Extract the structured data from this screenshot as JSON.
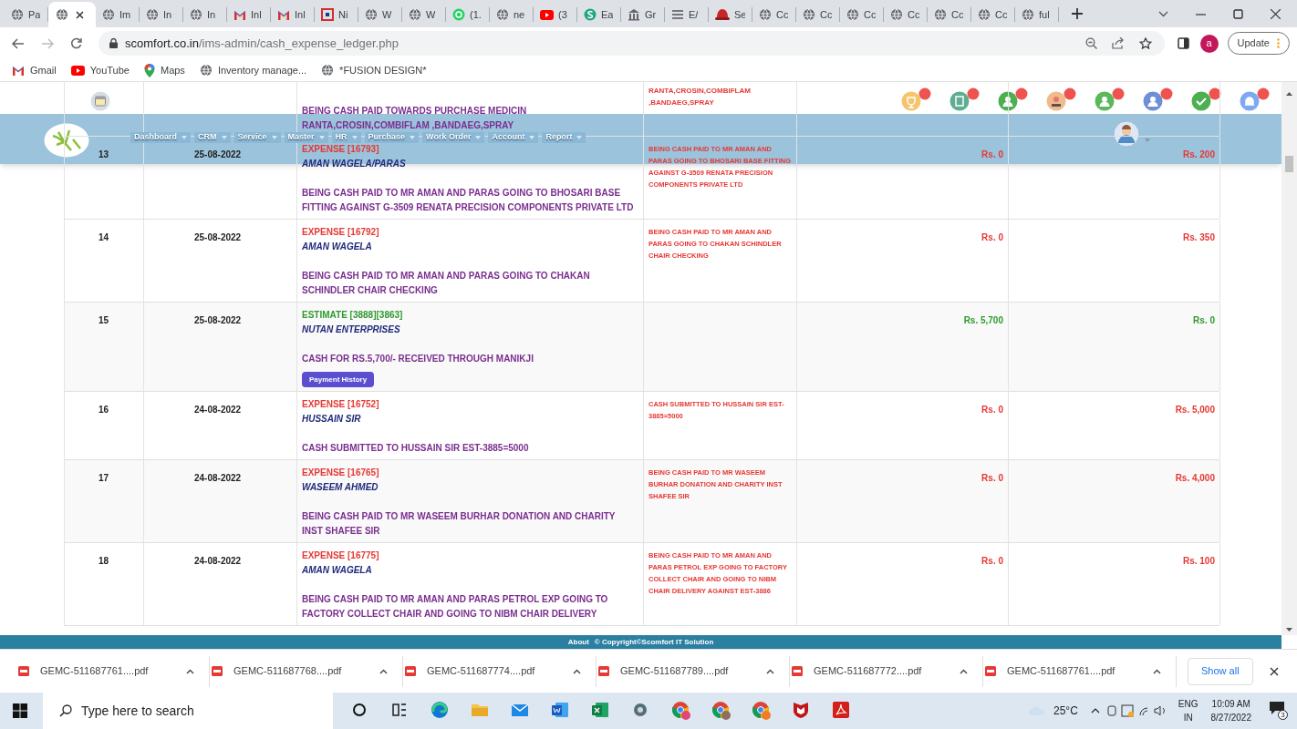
{
  "browser": {
    "tabs": [
      {
        "kind": "globe",
        "label": "Pa",
        "selected": false
      },
      {
        "kind": "globe",
        "selected": true
      },
      {
        "kind": "globe",
        "label": "Im",
        "selected": false
      },
      {
        "kind": "globe",
        "label": "In",
        "selected": false
      },
      {
        "kind": "globe",
        "label": "In",
        "selected": false
      },
      {
        "kind": "gmail",
        "label": "Inl",
        "selected": false
      },
      {
        "kind": "gmail",
        "label": "Inl",
        "selected": false
      },
      {
        "kind": "redbox",
        "label": "Ni",
        "selected": false
      },
      {
        "kind": "globe",
        "label": "W",
        "selected": false
      },
      {
        "kind": "globe",
        "label": "W",
        "selected": false
      },
      {
        "kind": "whatsapp",
        "label": "(1.",
        "selected": false
      },
      {
        "kind": "globe",
        "label": "ne",
        "selected": false
      },
      {
        "kind": "youtube",
        "label": "(3",
        "selected": false
      },
      {
        "kind": "scircle",
        "label": "Ea",
        "selected": false
      },
      {
        "kind": "building",
        "label": "Gr",
        "selected": false
      },
      {
        "kind": "bars",
        "label": "E/",
        "selected": false
      },
      {
        "kind": "hat",
        "label": "Se",
        "selected": false
      },
      {
        "kind": "globe",
        "label": "Cc",
        "selected": false
      },
      {
        "kind": "globe",
        "label": "Cc",
        "selected": false
      },
      {
        "kind": "globe",
        "label": "Cc",
        "selected": false
      },
      {
        "kind": "globe",
        "label": "Cc",
        "selected": false
      },
      {
        "kind": "globe",
        "label": "Cc",
        "selected": false
      },
      {
        "kind": "globe",
        "label": "Cc",
        "selected": false
      },
      {
        "kind": "globe",
        "label": "ful",
        "selected": false
      }
    ],
    "url_host": "scomfort.co.in",
    "url_path": "/ims-admin/cash_expense_ledger.php",
    "update_label": "Update",
    "profile_initial": "a",
    "bookmarks": [
      {
        "kind": "gmail",
        "label": "Gmail"
      },
      {
        "kind": "youtube",
        "label": "YouTube"
      },
      {
        "kind": "maps",
        "label": "Maps"
      },
      {
        "kind": "globe",
        "label": "Inventory manage..."
      },
      {
        "kind": "globe",
        "label": "*FUSION DESIGN*"
      }
    ]
  },
  "header": {
    "nav": [
      "Dashboard",
      "CRM",
      "Service",
      "Master",
      "HR",
      "Purchase",
      "Work Order",
      "Account",
      "Report"
    ],
    "notifications": [
      {
        "kind": "cup",
        "color": "#f5c56e"
      },
      {
        "kind": "document",
        "color": "#5fae93"
      },
      {
        "kind": "person",
        "color": "#4caf50"
      },
      {
        "kind": "people",
        "color": "#f2b98a"
      },
      {
        "kind": "person",
        "color": "#5cb85c"
      },
      {
        "kind": "person",
        "color": "#6d8fd6"
      },
      {
        "kind": "check",
        "color": "#4caf50"
      },
      {
        "kind": "bell",
        "color": "#7ea8f2"
      }
    ]
  },
  "ledger": {
    "partial_row": {
      "description_lines": [
        "BEING CASH PAID TOWARDS PURCHASE MEDICIN",
        "RANTA,CROSIN,COMBIFLAM ,BANDAEG,SPRAY"
      ],
      "remark_lines": [
        "RANTA,CROSIN,COMBIFLAM",
        ",BANDAEG,SPRAY"
      ]
    },
    "rows": [
      {
        "number": "13",
        "date": "25-08-2022",
        "kind": "expense",
        "type_label": "EXPENSE [16793]",
        "party": "AMAN WAGELA/PARAS",
        "description": "BEING CASH PAID TO MR AMAN AND PARAS GOING TO BHOSARI BASE FITTING AGAINST G-3509 RENATA PRECISION COMPONENTS PRIVATE LTD",
        "remark": "BEING CASH PAID TO MR AMAN AND PARAS GOING TO BHOSARI BASE FITTING AGAINST G-3509 RENATA PRECISION COMPONENTS PRIVATE LTD",
        "received": "Rs. 0",
        "paid": "Rs. 200"
      },
      {
        "number": "14",
        "date": "25-08-2022",
        "kind": "expense",
        "type_label": "EXPENSE [16792]",
        "party": "AMAN WAGELA",
        "description": "BEING CASH PAID TO MR AMAN AND PARAS GOING TO CHAKAN SCHINDLER CHAIR CHECKING",
        "remark": "BEING CASH PAID TO MR AMAN AND PARAS GOING TO CHAKAN SCHINDLER CHAIR CHECKING",
        "received": "Rs. 0",
        "paid": "Rs. 350"
      },
      {
        "number": "15",
        "date": "25-08-2022",
        "kind": "estimate",
        "type_label": "ESTIMATE [3888][3863]",
        "party": "NUTAN ENTERPRISES",
        "description": "CASH FOR RS.5,700/- RECEIVED THROUGH MANIKJI",
        "button": "Payment History",
        "received": "Rs. 5,700",
        "paid": "Rs. 0"
      },
      {
        "number": "16",
        "date": "24-08-2022",
        "kind": "expense",
        "type_label": "EXPENSE [16752]",
        "party": "HUSSAIN SIR",
        "description": "CASH SUBMITTED TO HUSSAIN SIR EST-3885=5000",
        "remark": "CASH SUBMITTED TO HUSSAIN SIR EST-3885=5000",
        "received": "Rs. 0",
        "paid": "Rs. 5,000"
      },
      {
        "number": "17",
        "date": "24-08-2022",
        "kind": "expense",
        "type_label": "EXPENSE [16765]",
        "party": "WASEEM AHMED",
        "description": "BEING CASH PAID TO MR WASEEM BURHAR DONATION AND CHARITY INST SHAFEE SIR",
        "remark": "BEING CASH PAID TO MR WASEEM BURHAR DONATION AND CHARITY INST SHAFEE SIR",
        "received": "Rs. 0",
        "paid": "Rs. 4,000"
      },
      {
        "number": "18",
        "date": "24-08-2022",
        "kind": "expense",
        "type_label": "EXPENSE [16775]",
        "party": "AMAN WAGELA",
        "description": "BEING CASH PAID TO MR AMAN AND PARAS PETROL EXP GOING TO FACTORY COLLECT CHAIR AND GOING TO NIBM CHAIR DELIVERY",
        "remark": "BEING CASH PAID TO MR AMAN AND PARAS PETROL EXP GOING TO FACTORY COLLECT CHAIR AND GOING TO NIBM CHAIR DELIVERY AGAINST EST-3886",
        "received": "Rs. 0",
        "paid": "Rs. 100"
      }
    ]
  },
  "footer": {
    "link": "About",
    "copyright": "© Copyright©Scomfort IT Solution"
  },
  "downloads": {
    "files": [
      "GEMC-511687761....pdf",
      "GEMC-511687768....pdf",
      "GEMC-511687774....pdf",
      "GEMC-511687789....pdf",
      "GEMC-511687772....pdf",
      "GEMC-511687761....pdf"
    ],
    "show_all": "Show all"
  },
  "taskbar": {
    "search_placeholder": "Type here to search",
    "apps": [
      {
        "kind": "cortana"
      },
      {
        "kind": "taskview"
      },
      {
        "kind": "edge"
      },
      {
        "kind": "folder"
      },
      {
        "kind": "mail"
      },
      {
        "kind": "word"
      },
      {
        "kind": "excel"
      },
      {
        "kind": "tool"
      },
      {
        "kind": "chrome",
        "color": "#e0457b"
      },
      {
        "kind": "chrome",
        "color": "#8d6e63"
      },
      {
        "kind": "chrome",
        "color": "#f07c2a"
      },
      {
        "kind": "shield"
      },
      {
        "kind": "acrobat"
      }
    ],
    "temperature": "25°C",
    "language": "ENG",
    "region": "IN",
    "time": "10:09 AM",
    "date": "8/27/2022",
    "notification_count": "3"
  }
}
